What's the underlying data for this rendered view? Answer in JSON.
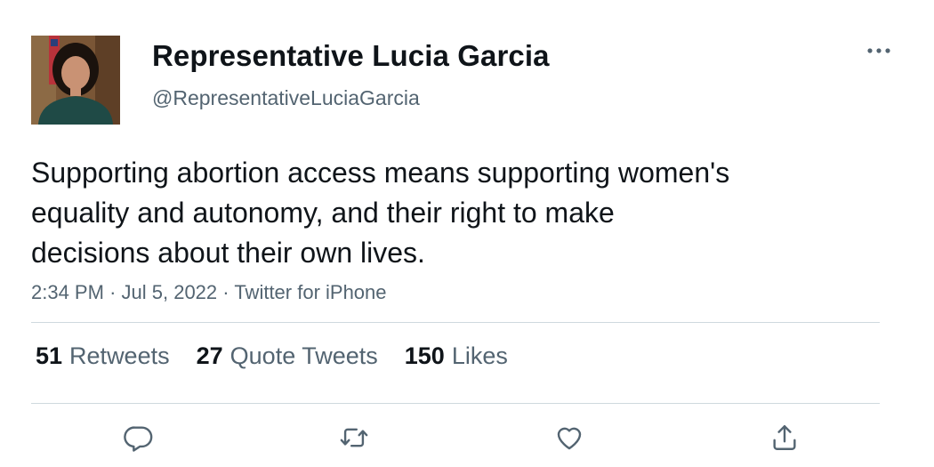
{
  "author": {
    "display_name": "Representative Lucia Garcia",
    "handle": "@RepresentativeLuciaGarcia"
  },
  "tweet": {
    "text": "Supporting abortion access means supporting women's\nequality and autonomy, and their right to make\ndecisions about their own lives.",
    "time": "2:34 PM",
    "separator": "·",
    "date": "Jul 5, 2022",
    "source": "Twitter for iPhone"
  },
  "stats": {
    "retweets": {
      "count": "51",
      "label": "Retweets"
    },
    "quote_tweets": {
      "count": "27",
      "label": "Quote Tweets"
    },
    "likes": {
      "count": "150",
      "label": "Likes"
    }
  },
  "icons": {
    "more": "more-horizontal-icon",
    "reply": "reply-icon",
    "retweet": "retweet-icon",
    "like": "heart-icon",
    "share": "share-icon"
  },
  "colors": {
    "text_primary": "#0f1419",
    "text_secondary": "#536471",
    "divider": "#cfd9de",
    "background": "#ffffff"
  }
}
